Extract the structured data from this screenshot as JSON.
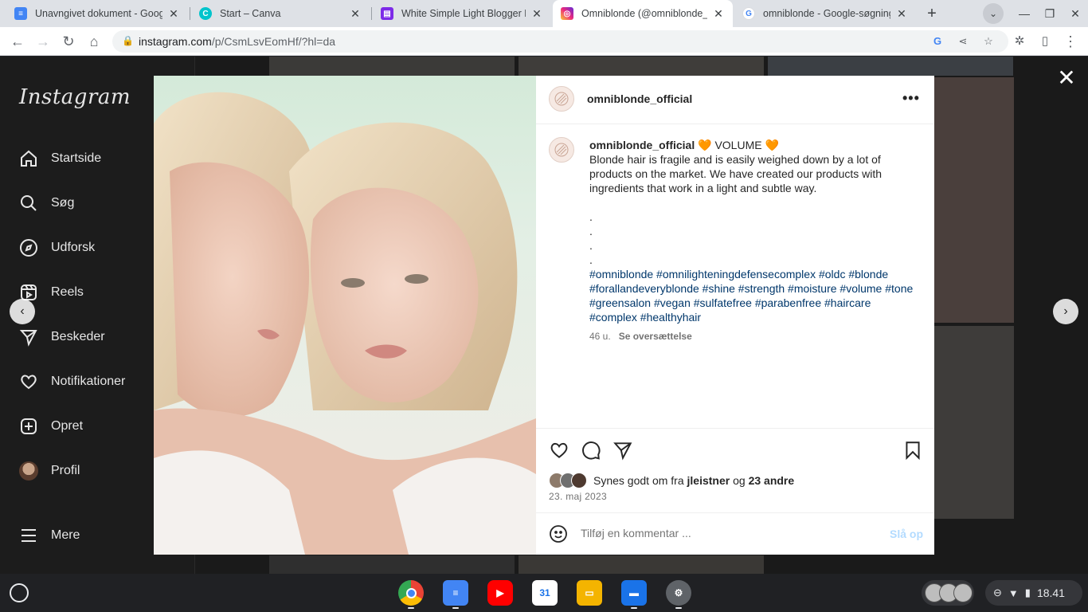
{
  "browser": {
    "tabs": [
      {
        "title": "Unavngivet dokument - Googl",
        "icon": "google-docs-icon",
        "color": "#4285f4",
        "active": false
      },
      {
        "title": "Start – Canva",
        "icon": "canva-icon",
        "color": "#00c4cc",
        "active": false
      },
      {
        "title": "White Simple Light Blogger Blo",
        "icon": "canva-design-icon",
        "color": "#7d2ae8",
        "active": false
      },
      {
        "title": "Omniblonde (@omniblonde_o",
        "icon": "instagram-icon",
        "color": "#e1306c",
        "active": true
      },
      {
        "title": "omniblonde - Google-søgning",
        "icon": "google-icon",
        "color": "#4285f4",
        "active": false
      }
    ],
    "url_host": "instagram.com",
    "url_path": "/p/CsmLsvEomHf/?hl=da"
  },
  "sidebar": {
    "logo": "Instagram",
    "items": [
      {
        "label": "Startside",
        "icon": "home-icon"
      },
      {
        "label": "Søg",
        "icon": "search-icon"
      },
      {
        "label": "Udforsk",
        "icon": "compass-icon"
      },
      {
        "label": "Reels",
        "icon": "reels-icon"
      },
      {
        "label": "Beskeder",
        "icon": "messenger-icon"
      },
      {
        "label": "Notifikationer",
        "icon": "heart-icon"
      },
      {
        "label": "Opret",
        "icon": "plus-square-icon"
      },
      {
        "label": "Profil",
        "icon": "profile-avatar-icon"
      }
    ],
    "more_label": "Mere"
  },
  "post": {
    "username": "omniblonde_official",
    "caption_title": "🧡 VOLUME 🧡",
    "caption_body": "Blonde hair is fragile and is easily weighed down by a lot of products on the market. We have created our products with ingredients that work in a light and subtle way.",
    "dots": [
      ".",
      ".",
      ".",
      "."
    ],
    "hashtags": "#omniblonde #omnilighteningdefensecomplex #oldc #blonde #forallandeveryblonde #shine #strength #moisture #volume #tone #greensalon #vegan #sulfatefree #parabenfree #haircare #complex #healthyhair",
    "age": "46 u.",
    "translate_label": "Se oversættelse",
    "likes_prefix": "Synes godt om fra",
    "likes_user": "jleistner",
    "likes_and": "og",
    "likes_others": "23 andre",
    "date": "23. maj 2023",
    "comment_placeholder": "Tilføj en kommentar ...",
    "post_button": "Slå op"
  },
  "shelf": {
    "apps": [
      {
        "name": "chrome-app",
        "color": "#4285f4",
        "running": true
      },
      {
        "name": "google-docs-app",
        "color": "#4285f4",
        "running": true
      },
      {
        "name": "youtube-app",
        "color": "#ff0000",
        "running": false
      },
      {
        "name": "google-calendar-app",
        "color": "#1a73e8",
        "running": false
      },
      {
        "name": "google-slides-app",
        "color": "#f4b400",
        "running": false
      },
      {
        "name": "files-app",
        "color": "#1a73e8",
        "running": true
      },
      {
        "name": "settings-app",
        "color": "#5f6368",
        "running": true
      }
    ],
    "time": "18.41"
  }
}
